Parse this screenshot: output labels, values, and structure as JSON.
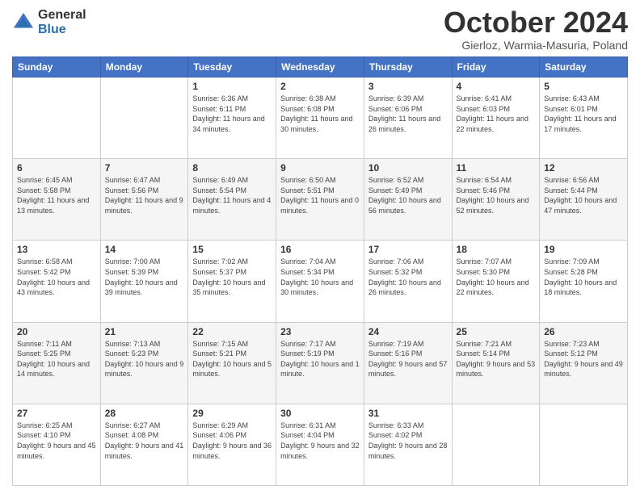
{
  "header": {
    "logo": {
      "general": "General",
      "blue": "Blue"
    },
    "title": "October 2024",
    "location": "Gierloz, Warmia-Masuria, Poland"
  },
  "weekdays": [
    "Sunday",
    "Monday",
    "Tuesday",
    "Wednesday",
    "Thursday",
    "Friday",
    "Saturday"
  ],
  "weeks": [
    [
      {
        "day": null
      },
      {
        "day": null
      },
      {
        "day": "1",
        "sunrise": "Sunrise: 6:36 AM",
        "sunset": "Sunset: 6:11 PM",
        "daylight": "Daylight: 11 hours and 34 minutes."
      },
      {
        "day": "2",
        "sunrise": "Sunrise: 6:38 AM",
        "sunset": "Sunset: 6:08 PM",
        "daylight": "Daylight: 11 hours and 30 minutes."
      },
      {
        "day": "3",
        "sunrise": "Sunrise: 6:39 AM",
        "sunset": "Sunset: 6:06 PM",
        "daylight": "Daylight: 11 hours and 26 minutes."
      },
      {
        "day": "4",
        "sunrise": "Sunrise: 6:41 AM",
        "sunset": "Sunset: 6:03 PM",
        "daylight": "Daylight: 11 hours and 22 minutes."
      },
      {
        "day": "5",
        "sunrise": "Sunrise: 6:43 AM",
        "sunset": "Sunset: 6:01 PM",
        "daylight": "Daylight: 11 hours and 17 minutes."
      }
    ],
    [
      {
        "day": "6",
        "sunrise": "Sunrise: 6:45 AM",
        "sunset": "Sunset: 5:58 PM",
        "daylight": "Daylight: 11 hours and 13 minutes."
      },
      {
        "day": "7",
        "sunrise": "Sunrise: 6:47 AM",
        "sunset": "Sunset: 5:56 PM",
        "daylight": "Daylight: 11 hours and 9 minutes."
      },
      {
        "day": "8",
        "sunrise": "Sunrise: 6:49 AM",
        "sunset": "Sunset: 5:54 PM",
        "daylight": "Daylight: 11 hours and 4 minutes."
      },
      {
        "day": "9",
        "sunrise": "Sunrise: 6:50 AM",
        "sunset": "Sunset: 5:51 PM",
        "daylight": "Daylight: 11 hours and 0 minutes."
      },
      {
        "day": "10",
        "sunrise": "Sunrise: 6:52 AM",
        "sunset": "Sunset: 5:49 PM",
        "daylight": "Daylight: 10 hours and 56 minutes."
      },
      {
        "day": "11",
        "sunrise": "Sunrise: 6:54 AM",
        "sunset": "Sunset: 5:46 PM",
        "daylight": "Daylight: 10 hours and 52 minutes."
      },
      {
        "day": "12",
        "sunrise": "Sunrise: 6:56 AM",
        "sunset": "Sunset: 5:44 PM",
        "daylight": "Daylight: 10 hours and 47 minutes."
      }
    ],
    [
      {
        "day": "13",
        "sunrise": "Sunrise: 6:58 AM",
        "sunset": "Sunset: 5:42 PM",
        "daylight": "Daylight: 10 hours and 43 minutes."
      },
      {
        "day": "14",
        "sunrise": "Sunrise: 7:00 AM",
        "sunset": "Sunset: 5:39 PM",
        "daylight": "Daylight: 10 hours and 39 minutes."
      },
      {
        "day": "15",
        "sunrise": "Sunrise: 7:02 AM",
        "sunset": "Sunset: 5:37 PM",
        "daylight": "Daylight: 10 hours and 35 minutes."
      },
      {
        "day": "16",
        "sunrise": "Sunrise: 7:04 AM",
        "sunset": "Sunset: 5:34 PM",
        "daylight": "Daylight: 10 hours and 30 minutes."
      },
      {
        "day": "17",
        "sunrise": "Sunrise: 7:06 AM",
        "sunset": "Sunset: 5:32 PM",
        "daylight": "Daylight: 10 hours and 26 minutes."
      },
      {
        "day": "18",
        "sunrise": "Sunrise: 7:07 AM",
        "sunset": "Sunset: 5:30 PM",
        "daylight": "Daylight: 10 hours and 22 minutes."
      },
      {
        "day": "19",
        "sunrise": "Sunrise: 7:09 AM",
        "sunset": "Sunset: 5:28 PM",
        "daylight": "Daylight: 10 hours and 18 minutes."
      }
    ],
    [
      {
        "day": "20",
        "sunrise": "Sunrise: 7:11 AM",
        "sunset": "Sunset: 5:25 PM",
        "daylight": "Daylight: 10 hours and 14 minutes."
      },
      {
        "day": "21",
        "sunrise": "Sunrise: 7:13 AM",
        "sunset": "Sunset: 5:23 PM",
        "daylight": "Daylight: 10 hours and 9 minutes."
      },
      {
        "day": "22",
        "sunrise": "Sunrise: 7:15 AM",
        "sunset": "Sunset: 5:21 PM",
        "daylight": "Daylight: 10 hours and 5 minutes."
      },
      {
        "day": "23",
        "sunrise": "Sunrise: 7:17 AM",
        "sunset": "Sunset: 5:19 PM",
        "daylight": "Daylight: 10 hours and 1 minute."
      },
      {
        "day": "24",
        "sunrise": "Sunrise: 7:19 AM",
        "sunset": "Sunset: 5:16 PM",
        "daylight": "Daylight: 9 hours and 57 minutes."
      },
      {
        "day": "25",
        "sunrise": "Sunrise: 7:21 AM",
        "sunset": "Sunset: 5:14 PM",
        "daylight": "Daylight: 9 hours and 53 minutes."
      },
      {
        "day": "26",
        "sunrise": "Sunrise: 7:23 AM",
        "sunset": "Sunset: 5:12 PM",
        "daylight": "Daylight: 9 hours and 49 minutes."
      }
    ],
    [
      {
        "day": "27",
        "sunrise": "Sunrise: 6:25 AM",
        "sunset": "Sunset: 4:10 PM",
        "daylight": "Daylight: 9 hours and 45 minutes."
      },
      {
        "day": "28",
        "sunrise": "Sunrise: 6:27 AM",
        "sunset": "Sunset: 4:08 PM",
        "daylight": "Daylight: 9 hours and 41 minutes."
      },
      {
        "day": "29",
        "sunrise": "Sunrise: 6:29 AM",
        "sunset": "Sunset: 4:06 PM",
        "daylight": "Daylight: 9 hours and 36 minutes."
      },
      {
        "day": "30",
        "sunrise": "Sunrise: 6:31 AM",
        "sunset": "Sunset: 4:04 PM",
        "daylight": "Daylight: 9 hours and 32 minutes."
      },
      {
        "day": "31",
        "sunrise": "Sunrise: 6:33 AM",
        "sunset": "Sunset: 4:02 PM",
        "daylight": "Daylight: 9 hours and 28 minutes."
      },
      {
        "day": null
      },
      {
        "day": null
      }
    ]
  ]
}
